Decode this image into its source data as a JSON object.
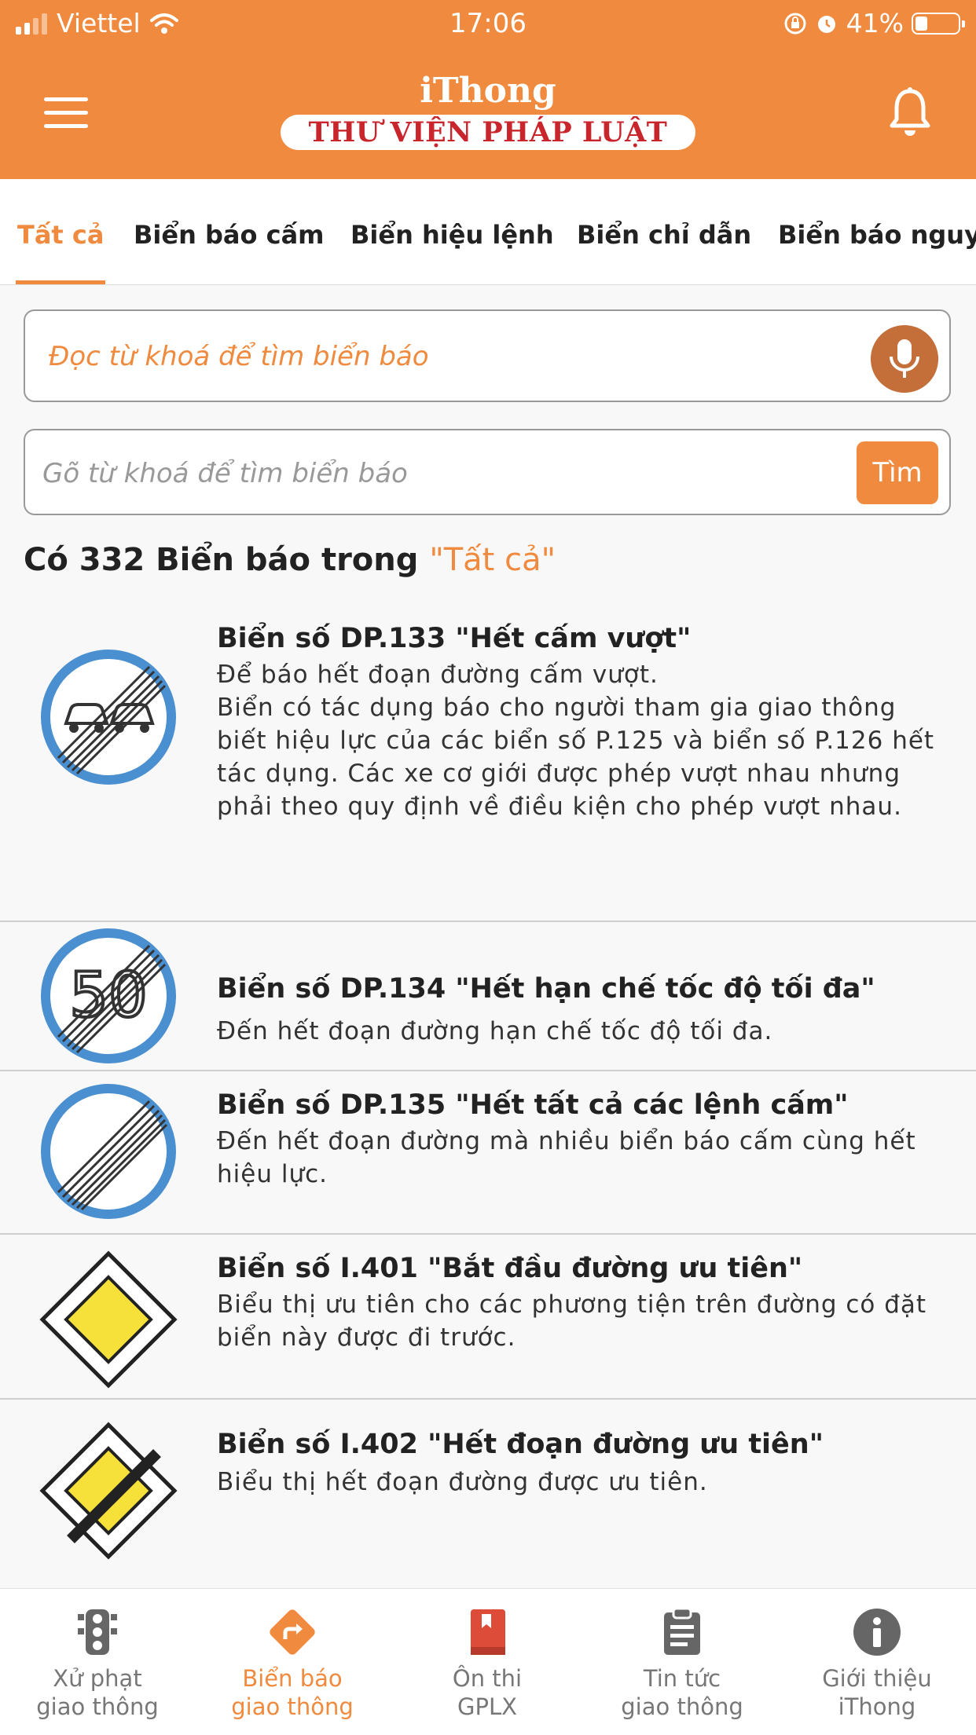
{
  "status_bar": {
    "carrier": "Viettel",
    "time": "17:06",
    "battery": "41%"
  },
  "header": {
    "app_name": "iThong",
    "subtitle": "THƯ VIỆN PHÁP LUẬT"
  },
  "tabs": [
    {
      "label": "Tất cả",
      "active": true
    },
    {
      "label": "Biển báo cấm"
    },
    {
      "label": "Biển hiệu lệnh"
    },
    {
      "label": "Biển chỉ dẫn"
    },
    {
      "label": "Biển báo nguy"
    }
  ],
  "voice_search": {
    "placeholder": "Đọc từ khoá để tìm biển báo"
  },
  "text_search": {
    "placeholder": "Gõ từ khoá để tìm biển báo",
    "button": "Tìm"
  },
  "summary": {
    "prefix": "Có 332 Biển báo trong",
    "category": "\"Tất cả\""
  },
  "signs": [
    {
      "title": "Biển số DP.133 \"Hết cấm vượt\"",
      "description": "Để báo hết đoạn đường cấm vượt.\nBiển có tác dụng báo cho người tham gia giao thông biết hiệu lực của các biển số P.125 và biển số P.126 hết tác dụng. Các xe cơ giới được phép vượt nhau nhưng phải theo quy định về điều kiện cho phép vượt nhau.",
      "icon": "end-no-overtaking-sign"
    },
    {
      "title": "Biển số DP.134 \"Hết hạn chế tốc độ tối đa\"",
      "description": "Đến hết đoạn đường hạn chế tốc độ tối đa.",
      "icon": "end-speed-limit-sign",
      "sign_text": "50"
    },
    {
      "title": "Biển số DP.135 \"Hết tất cả các lệnh cấm\"",
      "description": "Đến hết đoạn đường mà nhiều biển báo cấm cùng hết hiệu lực.",
      "icon": "end-all-restrictions-sign"
    },
    {
      "title": "Biển số I.401 \"Bắt đầu đường ưu tiên\"",
      "description": "Biểu thị ưu tiên cho các phương tiện trên đường có đặt biển này được đi trước.",
      "icon": "priority-road-sign"
    },
    {
      "title": "Biển số I.402 \"Hết đoạn đường ưu tiên\"",
      "description": "Biểu thị hết đoạn đường được ưu tiên.",
      "icon": "end-priority-road-sign"
    }
  ],
  "bottom_nav": [
    {
      "label1": "Xử phạt",
      "label2": "giao thông",
      "icon": "traffic-light-icon"
    },
    {
      "label1": "Biển báo",
      "label2": "giao thông",
      "icon": "direction-sign-icon",
      "active": true
    },
    {
      "label1": "Ôn thi",
      "label2": "GPLX",
      "icon": "book-icon"
    },
    {
      "label1": "Tin tức",
      "label2": "giao thông",
      "icon": "clipboard-icon"
    },
    {
      "label1": "Giới thiệu",
      "label2": "iThong",
      "icon": "info-icon"
    }
  ],
  "colors": {
    "accent": "#ef8a3e",
    "brand_red": "#c9252c",
    "sign_blue": "#4a8fd0",
    "sign_yellow": "#f5e13a"
  }
}
